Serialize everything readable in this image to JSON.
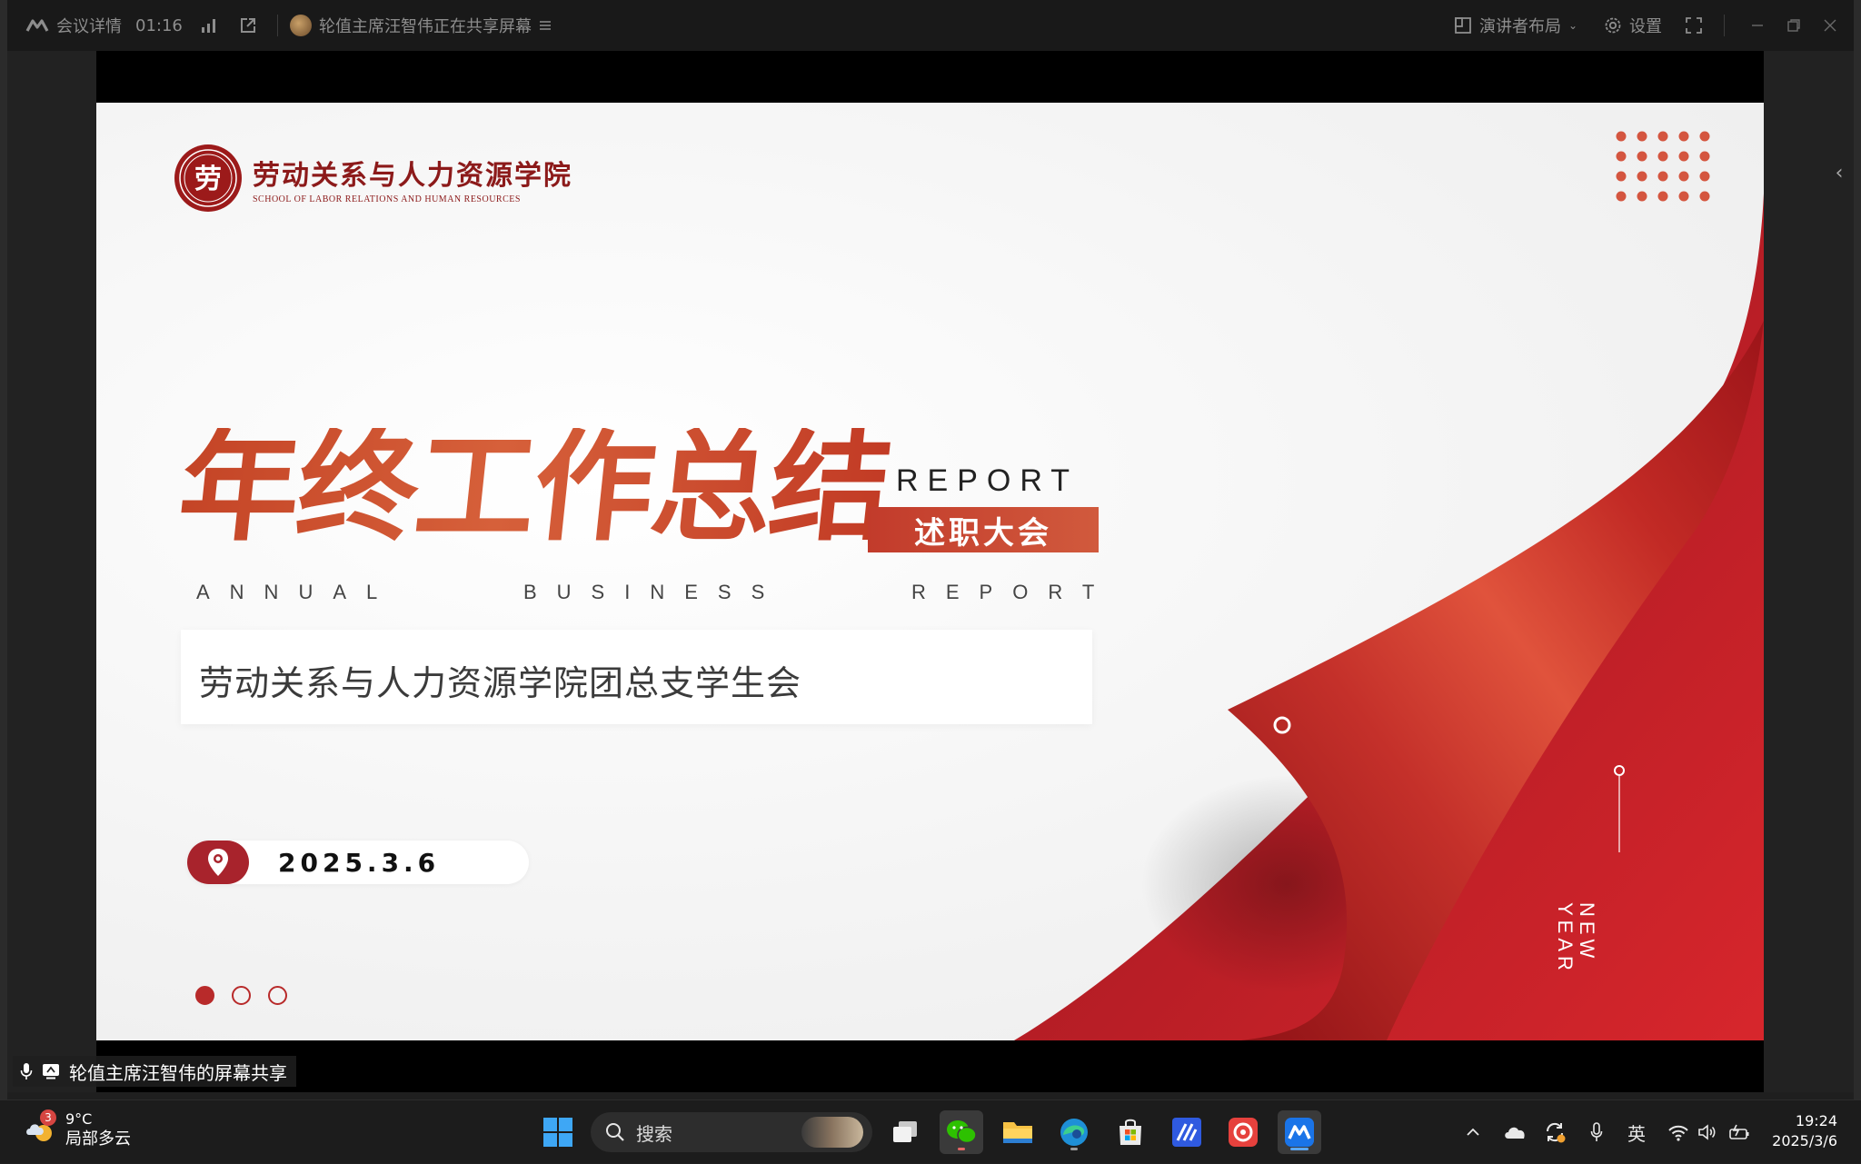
{
  "topbar": {
    "meeting_details": "会议详情",
    "timer": "01:16",
    "sharing_notice": "轮值主席汪智伟正在共享屏幕",
    "layout_label": "演讲者布局",
    "settings_label": "设置"
  },
  "slide": {
    "logo_cn": "劳动关系与人力资源学院",
    "logo_en": "SCHOOL OF LABOR RELATIONS AND HUMAN RESOURCES",
    "logo_seal_char": "劳",
    "title": "年终工作总结",
    "report_word": "REPORT",
    "badge": "述职大会",
    "annual_words": [
      "ANNUAL",
      "BUSINESS",
      "REPORT"
    ],
    "subtitle": "劳动关系与人力资源学院团总支学生会",
    "date": "2025.3.6",
    "new_year_lines": [
      "NEW",
      "YEAR"
    ],
    "page_dots": {
      "total": 3,
      "active": 0
    }
  },
  "share_caption": "轮值主席汪智伟的屏幕共享",
  "taskbar": {
    "weather_temp": "9°C",
    "weather_desc": "局部多云",
    "weather_badge": "3",
    "search_placeholder": "搜索",
    "ime_label": "英",
    "time": "19:24",
    "date": "2025/3/6"
  },
  "colors": {
    "brand_red": "#b82a2a",
    "title_orange_red": "#c94a2c",
    "taskbar_bg": "#1c1c1c"
  }
}
